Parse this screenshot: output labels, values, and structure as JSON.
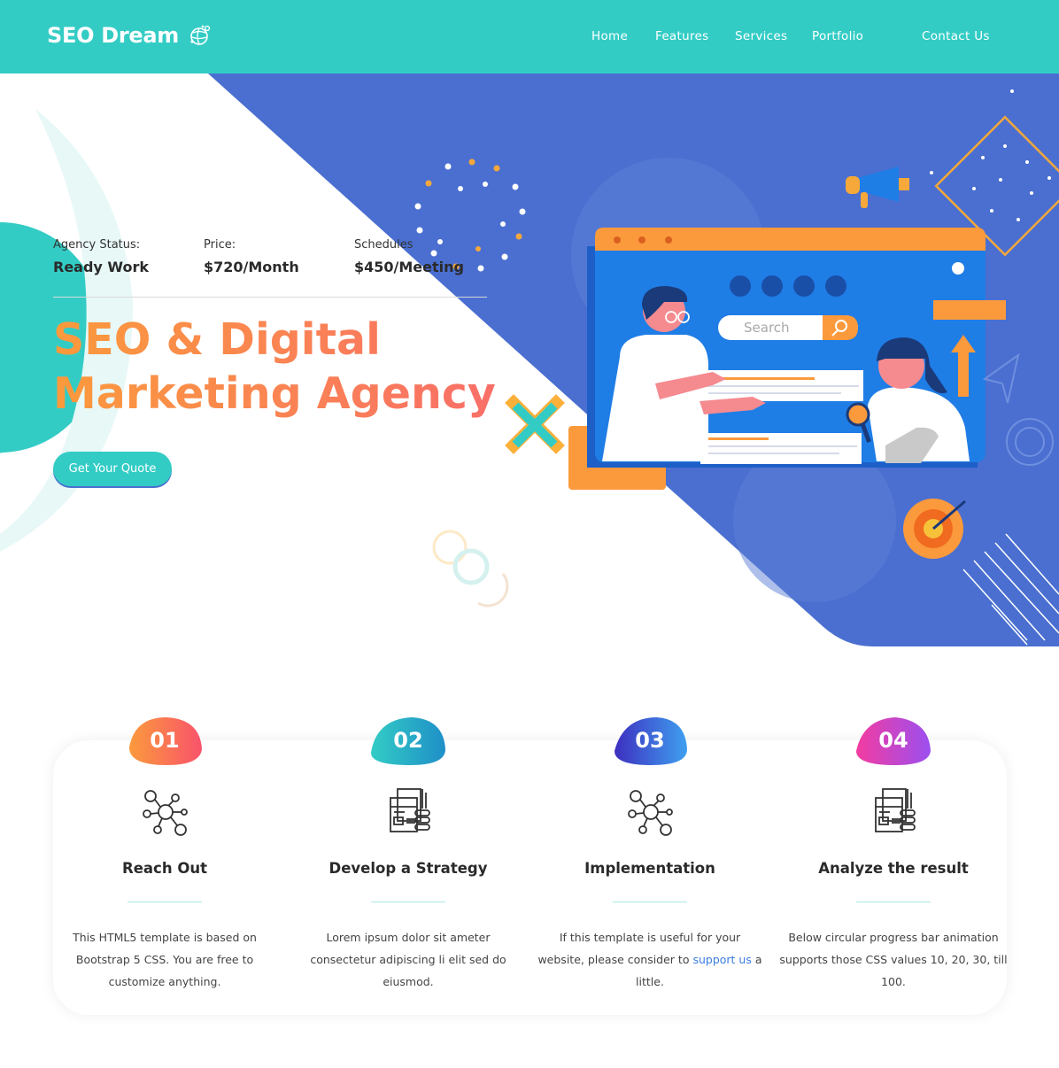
{
  "header": {
    "logo": "SEO Dream",
    "nav": [
      "Home",
      "Features",
      "Services",
      "Portfolio",
      "Contact Us"
    ]
  },
  "hero": {
    "meta": [
      {
        "label": "Agency Status:",
        "value": "Ready Work"
      },
      {
        "label": "Price:",
        "value": "$720/Month"
      },
      {
        "label": "Schedules",
        "value": "$450/Meeting"
      }
    ],
    "headline_line1": "SEO & Digital",
    "headline_line2": "Marketing Agency",
    "cta": "Get Your Quote",
    "search_placeholder": "Search"
  },
  "steps": [
    {
      "number": "01",
      "title": "Reach Out",
      "description": "This HTML5 template is based on Bootstrap 5 CSS. You are free to customize anything."
    },
    {
      "number": "02",
      "title": "Develop a Strategy",
      "description": "Lorem ipsum dolor sit ameter consectetur adipiscing li elit sed do eiusmod."
    },
    {
      "number": "03",
      "title": "Implementation",
      "description_before": "If this template is useful for your website, please consider to",
      "link": "support us",
      "description_after": "a little."
    },
    {
      "number": "04",
      "title": "Analyze the result",
      "description": "Below circular progress bar animation supports those CSS values 10, 20, 30, till 100."
    }
  ],
  "colors": {
    "teal": "#33ccc5",
    "blue": "#4a6fd0",
    "orange": "#fb9a3c",
    "coral": "#f96d6a",
    "link": "#3b7ddd"
  },
  "icons": [
    "seo-globe-icon",
    "network-people-icon",
    "documents-icon",
    "search-icon"
  ]
}
